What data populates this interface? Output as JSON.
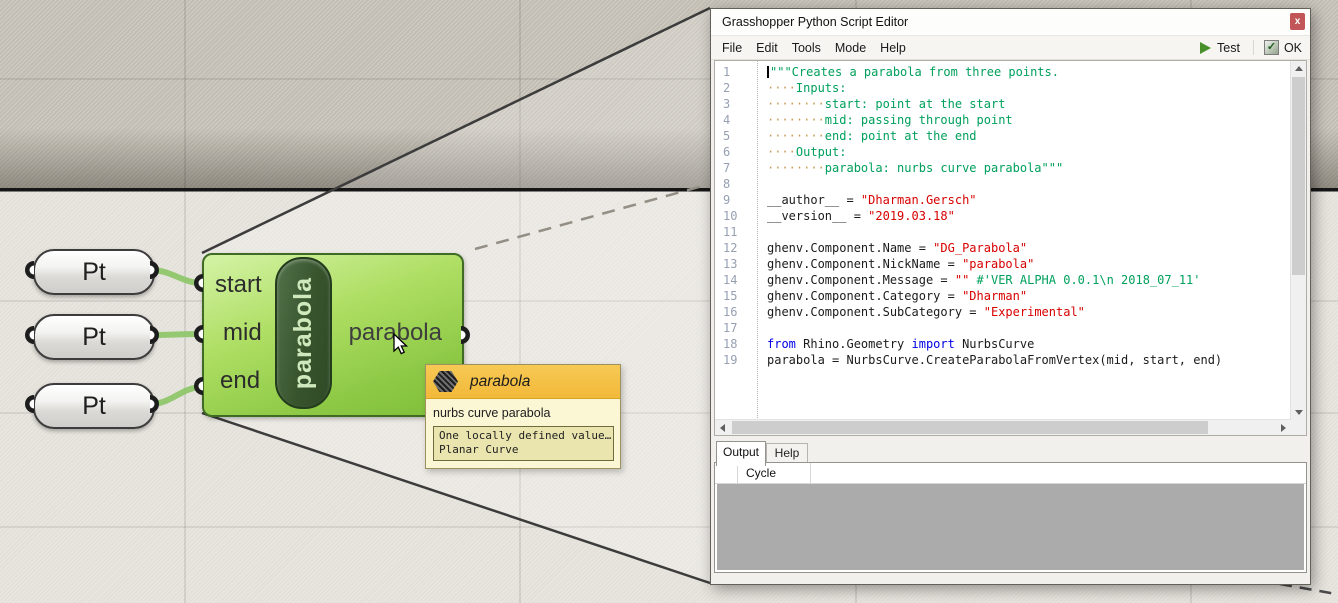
{
  "canvas": {
    "points": [
      {
        "label": "Pt"
      },
      {
        "label": "Pt"
      },
      {
        "label": "Pt"
      }
    ],
    "component": {
      "vertical_label": "parabola",
      "inputs": [
        {
          "label": "start"
        },
        {
          "label": "mid"
        },
        {
          "label": "end"
        }
      ],
      "output_label": "parabola"
    },
    "tooltip": {
      "title": "parabola",
      "description": "nurbs curve parabola",
      "value_summary": "One locally defined value…",
      "value_type": "Planar Curve"
    }
  },
  "editor": {
    "window_title": "Grasshopper Python Script Editor",
    "close_label": "x",
    "menu_items": [
      {
        "label": "File"
      },
      {
        "label": "Edit"
      },
      {
        "label": "Tools"
      },
      {
        "label": "Mode"
      },
      {
        "label": "Help"
      }
    ],
    "toolbar": {
      "test_label": "Test",
      "ok_label": "OK",
      "ok_check": "✓"
    },
    "code": {
      "lines": [
        {
          "num": 1,
          "caret": true,
          "segments": [
            {
              "c": "ds",
              "t": "\"\"\"Creates a parabola from three points."
            }
          ]
        },
        {
          "num": 2,
          "segments": [
            {
              "c": "ws",
              "t": "····"
            },
            {
              "c": "ds",
              "t": "Inputs:"
            }
          ]
        },
        {
          "num": 3,
          "segments": [
            {
              "c": "ws",
              "t": "········"
            },
            {
              "c": "ds",
              "t": "start: point at the start"
            }
          ]
        },
        {
          "num": 4,
          "segments": [
            {
              "c": "ws",
              "t": "········"
            },
            {
              "c": "ds",
              "t": "mid: passing through point"
            }
          ]
        },
        {
          "num": 5,
          "segments": [
            {
              "c": "ws",
              "t": "········"
            },
            {
              "c": "ds",
              "t": "end: point at the end"
            }
          ]
        },
        {
          "num": 6,
          "segments": [
            {
              "c": "ws",
              "t": "····"
            },
            {
              "c": "ds",
              "t": "Output:"
            }
          ]
        },
        {
          "num": 7,
          "segments": [
            {
              "c": "ws",
              "t": "········"
            },
            {
              "c": "ds",
              "t": "parabola: nurbs curve parabola\"\"\""
            }
          ]
        },
        {
          "num": 8,
          "segments": []
        },
        {
          "num": 9,
          "segments": [
            {
              "c": "code",
              "t": "__author__ = "
            },
            {
              "c": "str",
              "t": "\"Dharman.Gersch\""
            }
          ]
        },
        {
          "num": 10,
          "segments": [
            {
              "c": "code",
              "t": "__version__ = "
            },
            {
              "c": "str",
              "t": "\"2019.03.18\""
            }
          ]
        },
        {
          "num": 11,
          "segments": []
        },
        {
          "num": 12,
          "segments": [
            {
              "c": "code",
              "t": "ghenv.Component.Name = "
            },
            {
              "c": "str",
              "t": "\"DG_Parabola\""
            }
          ]
        },
        {
          "num": 13,
          "segments": [
            {
              "c": "code",
              "t": "ghenv.Component.NickName = "
            },
            {
              "c": "str",
              "t": "\"parabola\""
            }
          ]
        },
        {
          "num": 14,
          "segments": [
            {
              "c": "code",
              "t": "ghenv.Component.Message = "
            },
            {
              "c": "str",
              "t": "\"\""
            },
            {
              "c": "code",
              "t": " "
            },
            {
              "c": "com",
              "t": "#'VER ALPHA 0.0.1\\n 2018_07_11'"
            }
          ]
        },
        {
          "num": 15,
          "segments": [
            {
              "c": "code",
              "t": "ghenv.Component.Category = "
            },
            {
              "c": "str",
              "t": "\"Dharman\""
            }
          ]
        },
        {
          "num": 16,
          "segments": [
            {
              "c": "code",
              "t": "ghenv.Component.SubCategory = "
            },
            {
              "c": "str",
              "t": "\"Experimental\""
            }
          ]
        },
        {
          "num": 17,
          "segments": []
        },
        {
          "num": 18,
          "segments": [
            {
              "c": "kw",
              "t": "from"
            },
            {
              "c": "code",
              "t": " Rhino.Geometry "
            },
            {
              "c": "kw",
              "t": "import"
            },
            {
              "c": "code",
              "t": " NurbsCurve"
            }
          ]
        },
        {
          "num": 19,
          "segments": [
            {
              "c": "code",
              "t": "parabola = NurbsCurve.CreateParabolaFromVertex(mid, start, end)"
            }
          ]
        }
      ]
    },
    "output_panel": {
      "tabs": [
        {
          "label": "Output",
          "active": true
        },
        {
          "label": "Help",
          "active": false
        }
      ],
      "cycle_header": "Cycle"
    }
  },
  "colors": {
    "component_green": "#8cc844",
    "wire_green": "#8bc565",
    "tooltip_amber": "#f2b93a",
    "close_red": "#c15558",
    "code_string": "#d80000",
    "code_comment": "#00a05c",
    "code_keyword": "#0000e6",
    "code_whitespace": "#c89a55",
    "canvas_dark": "#c8c3b9",
    "canvas_light": "#e7e4dd"
  }
}
